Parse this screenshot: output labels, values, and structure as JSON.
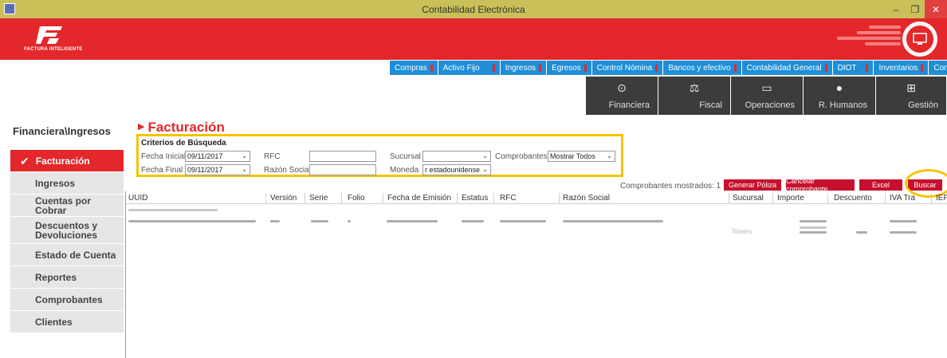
{
  "window": {
    "title": "Contabilidad Electrónica",
    "minimize": "–",
    "maximize": "❐",
    "close": "✕"
  },
  "logo": {
    "text": "FACTURA INTELIGENTE"
  },
  "menu": [
    {
      "label": "Compras",
      "flag": true
    },
    {
      "label": "Activo Fijo",
      "flag": true
    },
    {
      "label": "Ingresos",
      "flag": true
    },
    {
      "label": "Egresos",
      "flag": true
    },
    {
      "label": "Control Nómina",
      "flag": true
    },
    {
      "label": "Bancos y efectivo",
      "flag": true
    },
    {
      "label": "Contabilidad General",
      "flag": true
    },
    {
      "label": "DIOT",
      "flag": true
    },
    {
      "label": "Inventarios",
      "flag": true
    },
    {
      "label": "Configuración",
      "flag": false
    }
  ],
  "tiles": [
    {
      "label": "Financiera",
      "icon": "coins-icon",
      "glyph": "⊙"
    },
    {
      "label": "Fiscal",
      "icon": "scale-icon",
      "glyph": "⚖"
    },
    {
      "label": "Operaciones",
      "icon": "monitor-icon",
      "glyph": "▭"
    },
    {
      "label": "R. Humanos",
      "icon": "person-icon",
      "glyph": "●"
    },
    {
      "label": "Gestión",
      "icon": "org-chart-icon",
      "glyph": "⊞"
    }
  ],
  "breadcrumb": "Financiera\\Ingresos",
  "sidebar": [
    {
      "label": "Facturación",
      "active": true
    },
    {
      "label": "Ingresos"
    },
    {
      "label": "Cuentas por Cobrar"
    },
    {
      "label": "Descuentos y Devoluciones"
    },
    {
      "label": "Estado de Cuenta"
    },
    {
      "label": "Reportes"
    },
    {
      "label": "Comprobantes"
    },
    {
      "label": "Clientes"
    }
  ],
  "section_title": "Facturación",
  "criteria": {
    "title": "Criterios de Búsqueda",
    "fecha_inicial_label": "Fecha Inicial",
    "fecha_inicial": "09/11/2017",
    "fecha_final_label": "Fecha Final",
    "fecha_final": "09/11/2017",
    "rfc_label": "RFC",
    "rfc": "",
    "razon_social_label": "Razón Social",
    "razon_social": "",
    "sucursal_label": "Sucursal",
    "sucursal": "",
    "moneda_label": "Moneda",
    "moneda": "r estadounidense",
    "comprobantes_label": "Comprobantes",
    "comprobantes": "Mostrar Todos"
  },
  "shown_label": "Comprobantes mostrados: 1",
  "buttons": {
    "generar_poliza": "Generar Póliza",
    "cancelar": "Cancelar comprobante",
    "excel": "Excel",
    "buscar": "Buscar"
  },
  "grid": {
    "columns": [
      "UUID",
      "Versión",
      "Serie",
      "Folio",
      "Fecha de Emisión",
      "Estatus",
      "RFC",
      "Razón Social",
      "Sucursal",
      "Importe",
      "Descuento",
      "IVA Tra",
      "IEPS"
    ],
    "totals_label": "Totales"
  },
  "colors": {
    "brand_red": "#e3272a",
    "menu_blue": "#1e8fd6",
    "tile_dark": "#3c3c3c",
    "highlight": "#f5c400"
  }
}
